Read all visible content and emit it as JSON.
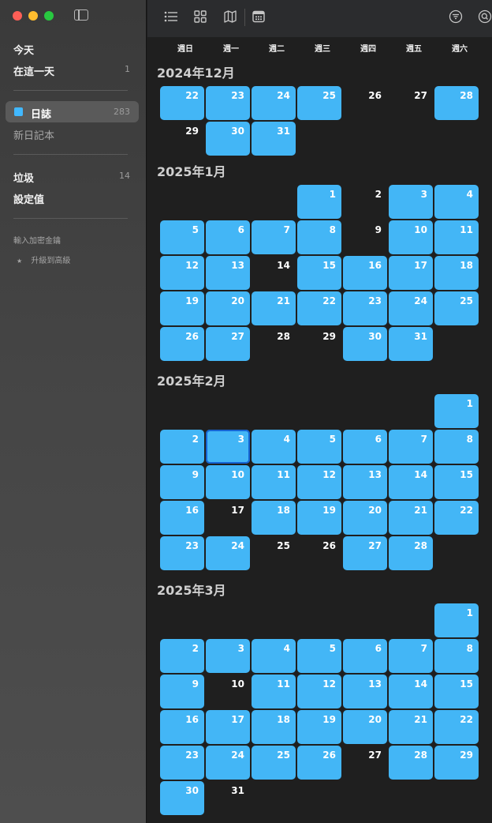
{
  "sidebar": {
    "today": "今天",
    "on_this_day": "在這一天",
    "on_this_day_count": "1",
    "journal": "日誌",
    "journal_count": "283",
    "new_notebook": "新日記本",
    "trash": "垃圾",
    "trash_count": "14",
    "settings": "設定值",
    "enter_key": "輸入加密金鑰",
    "upgrade_star": "★",
    "upgrade": "升級到高級"
  },
  "toolbar": {
    "list_icon": "list-icon",
    "grid_icon": "grid-icon",
    "map_icon": "map-icon",
    "calendar_icon": "calendar-icon",
    "filter_icon": "filter-icon",
    "search_icon": "search-icon"
  },
  "weekdays": [
    "週日",
    "週一",
    "週二",
    "週三",
    "週四",
    "週五",
    "週六"
  ],
  "colors": {
    "entry": "#43b6f6",
    "selected_border": "#1565d4"
  },
  "months": [
    {
      "title": "2024年12月",
      "first_weekday": 0,
      "first_day": 22,
      "last_day": 31,
      "entries": [
        22,
        23,
        24,
        25,
        28,
        30,
        31
      ]
    },
    {
      "title": "2025年1月",
      "first_weekday": 3,
      "first_day": 1,
      "last_day": 31,
      "entries": [
        1,
        3,
        4,
        5,
        6,
        7,
        8,
        10,
        11,
        12,
        13,
        15,
        16,
        17,
        18,
        19,
        20,
        21,
        22,
        23,
        24,
        25,
        26,
        27,
        30,
        31
      ]
    },
    {
      "title": "2025年2月",
      "first_weekday": 6,
      "first_day": 1,
      "last_day": 28,
      "entries": [
        1,
        2,
        3,
        4,
        5,
        6,
        7,
        8,
        9,
        10,
        11,
        12,
        13,
        14,
        15,
        16,
        18,
        19,
        20,
        21,
        22,
        23,
        24,
        27,
        28
      ],
      "selected": 3
    },
    {
      "title": "2025年3月",
      "first_weekday": 6,
      "first_day": 1,
      "last_day": 31,
      "entries": [
        1,
        2,
        3,
        4,
        5,
        6,
        7,
        8,
        9,
        11,
        12,
        13,
        14,
        15,
        16,
        17,
        18,
        19,
        20,
        21,
        22,
        23,
        24,
        25,
        26,
        28,
        29,
        30
      ]
    }
  ]
}
